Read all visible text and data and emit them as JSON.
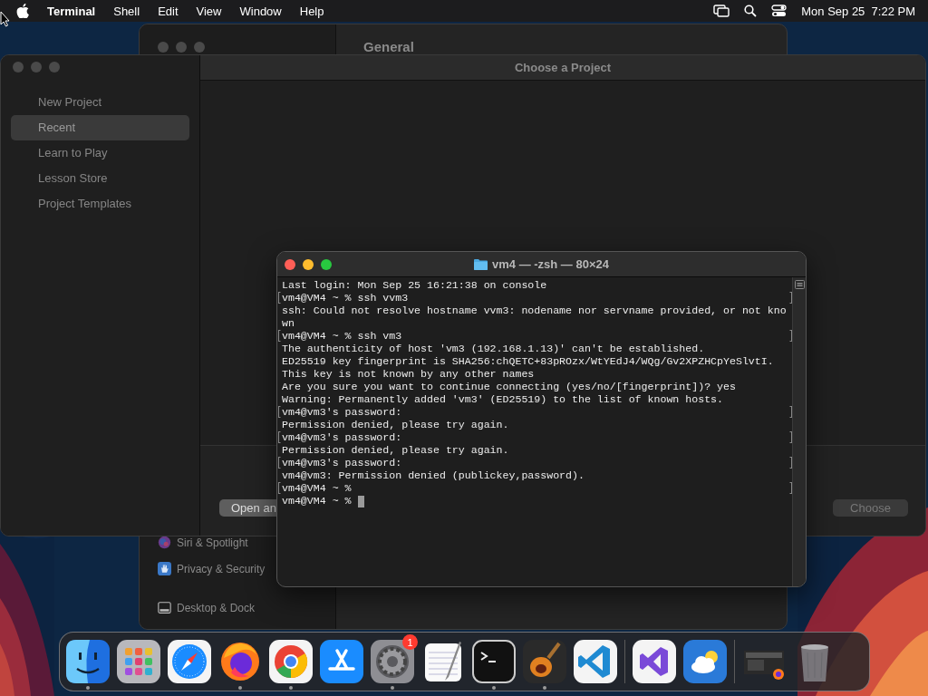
{
  "menu_bar": {
    "app_name": "Terminal",
    "menus": [
      "Shell",
      "Edit",
      "View",
      "Window",
      "Help"
    ],
    "clock": "Mon Sep 25  7:22 PM"
  },
  "settings_window": {
    "title": "General",
    "sidebar_items": [
      "Siri & Spotlight",
      "Privacy & Security",
      "Desktop & Dock"
    ]
  },
  "project_window": {
    "title": "Choose a Project",
    "sidebar": [
      {
        "label": "New Project",
        "selected": false
      },
      {
        "label": "Recent",
        "selected": true
      },
      {
        "label": "Learn to Play",
        "selected": false
      },
      {
        "label": "Lesson Store",
        "selected": false
      },
      {
        "label": "Project Templates",
        "selected": false
      }
    ],
    "buttons": [
      {
        "label": "Open an",
        "disabled": false
      },
      {
        "label": "Choose",
        "disabled": true
      }
    ]
  },
  "terminal": {
    "title": "vm4 — -zsh — 80×24",
    "cursor": true,
    "lines": [
      {
        "text": "Last login: Mon Sep 25 16:21:38 on console",
        "marked": false
      },
      {
        "text": "vm4@VM4 ~ % ssh vvm3",
        "marked": true
      },
      {
        "text": "ssh: Could not resolve hostname vvm3: nodename nor servname provided, or not kno",
        "marked": false
      },
      {
        "text": "wn",
        "marked": false
      },
      {
        "text": "vm4@VM4 ~ % ssh vm3",
        "marked": true
      },
      {
        "text": "The authenticity of host 'vm3 (192.168.1.13)' can't be established.",
        "marked": false
      },
      {
        "text": "ED25519 key fingerprint is SHA256:chQETC+83pROzx/WtYEdJ4/WQg/Gv2XPZHCpYeSlvtI.",
        "marked": false
      },
      {
        "text": "This key is not known by any other names",
        "marked": false
      },
      {
        "text": "Are you sure you want to continue connecting (yes/no/[fingerprint])? yes",
        "marked": false
      },
      {
        "text": "Warning: Permanently added 'vm3' (ED25519) to the list of known hosts.",
        "marked": false
      },
      {
        "text": "vm4@vm3's password:",
        "marked": true
      },
      {
        "text": "Permission denied, please try again.",
        "marked": false
      },
      {
        "text": "vm4@vm3's password:",
        "marked": true
      },
      {
        "text": "Permission denied, please try again.",
        "marked": false
      },
      {
        "text": "vm4@vm3's password:",
        "marked": true
      },
      {
        "text": "vm4@vm3: Permission denied (publickey,password).",
        "marked": false
      },
      {
        "text": "vm4@VM4 ~ %",
        "marked": true
      },
      {
        "text": "vm4@VM4 ~ %",
        "marked": false
      }
    ]
  },
  "dock": {
    "groups": [
      {
        "items": [
          {
            "running": true
          },
          {
            "running": false
          },
          {
            "running": false
          },
          {
            "running": true
          },
          {
            "running": true
          },
          {
            "running": false
          },
          {
            "running": true,
            "badge": "1"
          },
          {
            "running": false
          },
          {
            "running": true
          },
          {
            "running": true
          },
          {
            "running": false
          }
        ]
      },
      {
        "items": [
          {
            "running": false
          },
          {
            "running": false
          }
        ]
      },
      {
        "items": [
          {
            "running": false
          },
          {
            "running": false
          }
        ]
      }
    ]
  }
}
